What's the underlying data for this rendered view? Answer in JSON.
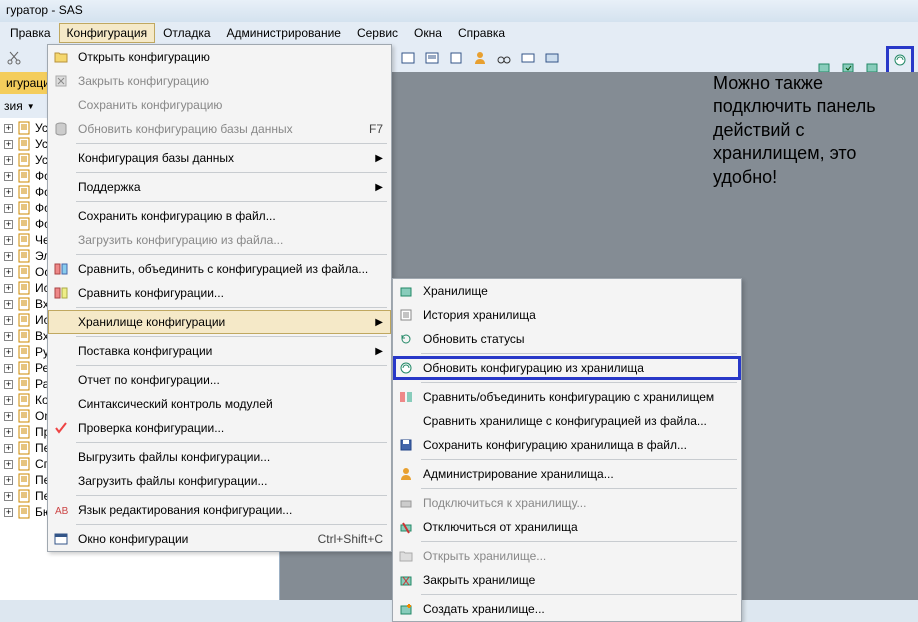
{
  "titlebar": "гуратор - SAS",
  "menubar": {
    "file": "Правка",
    "config": "Конфигурация",
    "debug": "Отладка",
    "admin": "Администрирование",
    "service": "Сервис",
    "windows": "Окна",
    "help": "Справка"
  },
  "sidebar": {
    "title": "игураци",
    "subtitle": "зия",
    "items": [
      "Уст",
      "Уст",
      "Уст",
      "Фо",
      "Фо",
      "Фо",
      "Фо",
      "Чен",
      "Эле",
      "Ос",
      "Исх",
      "Вхо",
      "Исх",
      "Вхо",
      "Руч",
      "Рег",
      "Рас",
      "Кор",
      "One",
      "ПринятиеКУчетуОС",
      "ПеремещениеОС",
      "СписаниеОС",
      "ПередачаОС",
      "ПереоценкаОС",
      "БюджетДоходовИРасходов"
    ]
  },
  "menu": {
    "open_config": "Открыть конфигурацию",
    "close_config": "Закрыть конфигурацию",
    "save_config": "Сохранить конфигурацию",
    "update_db": "Обновить конфигурацию базы данных",
    "update_db_key": "F7",
    "db_config": "Конфигурация базы данных",
    "support": "Поддержка",
    "save_to_file": "Сохранить конфигурацию в файл...",
    "load_from_file": "Загрузить конфигурацию из файла...",
    "compare_merge": "Сравнить, объединить с конфигурацией из файла...",
    "compare_configs": "Сравнить конфигурации...",
    "repo": "Хранилище конфигурации",
    "delivery": "Поставка конфигурации",
    "report": "Отчет по конфигурации...",
    "syntax_check": "Синтаксический контроль модулей",
    "check_config": "Проверка конфигурации...",
    "export_files": "Выгрузить файлы конфигурации...",
    "import_files": "Загрузить файлы конфигурации...",
    "edit_lang": "Язык редактирования конфигурации...",
    "config_window": "Окно конфигурации",
    "config_window_key": "Ctrl+Shift+C"
  },
  "submenu": {
    "repo": "Хранилище",
    "history": "История хранилища",
    "update_status": "Обновить статусы",
    "update_from": "Обновить конфигурацию из хранилища",
    "compare_merge": "Сравнить/объединить конфигурацию с хранилищем",
    "compare_file": "Сравнить хранилище с конфигурацией из файла...",
    "save_to_file": "Сохранить конфигурацию хранилища в файл...",
    "admin": "Администрирование хранилища...",
    "connect": "Подключиться к хранилищу...",
    "disconnect": "Отключиться от хранилища",
    "open": "Открыть хранилище...",
    "close": "Закрыть хранилище",
    "create": "Создать хранилище..."
  },
  "annotation": "Можно также подключить панель действий с хранилищем, это удобно!"
}
